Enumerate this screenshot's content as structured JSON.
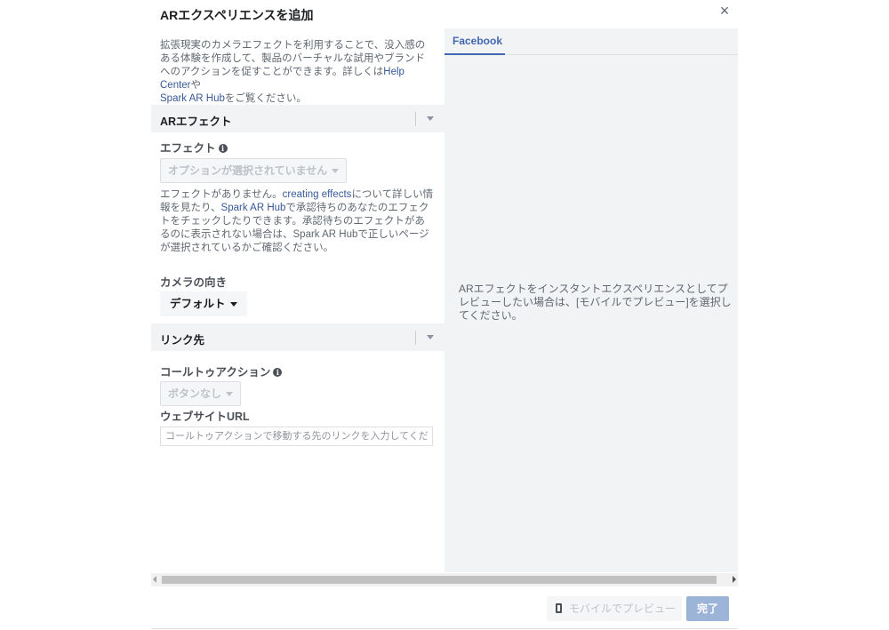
{
  "dialog": {
    "title": "ARエクスペリエンスを追加",
    "close_icon": "close-icon"
  },
  "intro": {
    "text_before": "拡張現実のカメラエフェクトを利用することで、没入感のある体験を作成して、製品のバーチャルな試用やブランドへのアクションを促すことができます。詳しくは",
    "link1": "Help Center",
    "text_mid": "や",
    "link2": "Spark AR Hub",
    "text_after": "をご覧ください。"
  },
  "ar_effect_section": {
    "title": "ARエフェクト",
    "effect_label": "エフェクト",
    "effect_select": "オプションが選択されていません",
    "desc_before": "エフェクトがありません。",
    "desc_link1": "creating effects",
    "desc_mid1": "について詳しい情報を見たり、",
    "desc_link2": "Spark AR Hub",
    "desc_after": "で承認待ちのあなたのエフェクトをチェックしたりできます。承認待ちのエフェクトがあるのに表示されない場合は、Spark AR Hubで正しいページが選択されているかご確認ください。",
    "camera_label": "カメラの向き",
    "camera_value": "デフォルト"
  },
  "link_section": {
    "title": "リンク先",
    "cta_label": "コールトゥアクション",
    "cta_value": "ボタンなし",
    "url_label": "ウェブサイトURL",
    "url_placeholder": "コールトゥアクションで移動する先のリンクを入力してください",
    "url_value": ""
  },
  "preview": {
    "tab": "Facebook",
    "message": "ARエフェクトをインスタントエクスペリエンスとしてプレビューしたい場合は、[モバイルでプレビュー]を選択してください。"
  },
  "footer": {
    "mobile_preview": "モバイルでプレビュー",
    "done": "完了"
  },
  "colors": {
    "link": "#385898",
    "tab_active": "#4267b2",
    "done_button": "#9cb4d8",
    "panel_bg": "#f2f3f5"
  }
}
